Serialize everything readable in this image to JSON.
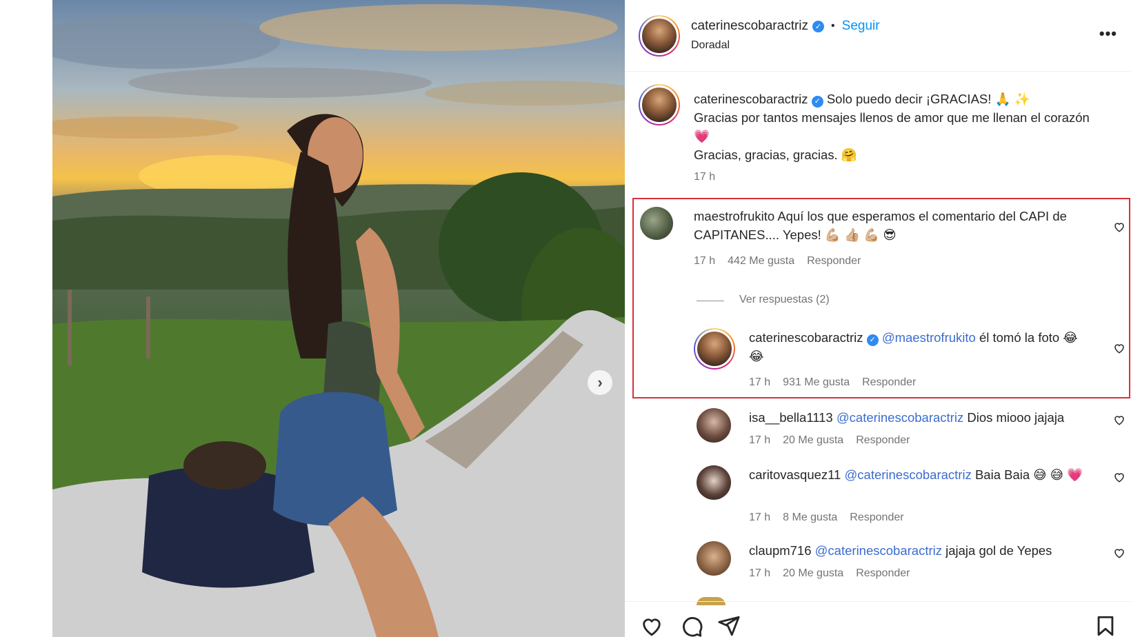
{
  "post": {
    "author": "caterinescobaractriz",
    "follow_label": "Seguir",
    "separator": "•",
    "location": "Doradal",
    "more_label": "•••"
  },
  "caption": {
    "user": "caterinescobaractriz",
    "line1": "Solo puedo decir ¡GRACIAS! 🙏 ✨",
    "line2": "Gracias por tantos mensajes llenos de amor que me llenan el corazón 💗",
    "line3": "Gracias, gracias, gracias. 🤗",
    "time": "17 h"
  },
  "comments": [
    {
      "user": "maestrofrukito",
      "text": "Aquí los que esperamos el comentario del CAPI de CAPITANES.... Yepes! 💪🏼 👍🏼 💪🏼 😎",
      "time": "17 h",
      "likes": "442 Me gusta",
      "reply": "Responder",
      "view_replies": "Ver respuestas (2)"
    },
    {
      "user": "caterinescobaractriz",
      "mention": "@maestrofrukito",
      "text": "él tomó la foto 😂 😂",
      "time": "17 h",
      "likes": "931 Me gusta",
      "reply": "Responder"
    },
    {
      "user": "isa__bella1113",
      "mention": "@caterinescobaractriz",
      "text": "Dios miooo jajaja",
      "time": "17 h",
      "likes": "20 Me gusta",
      "reply": "Responder"
    },
    {
      "user": "caritovasquez11",
      "mention": "@caterinescobaractriz",
      "text": "Baia Baia 😅 😅 💗",
      "time": "17 h",
      "likes": "8 Me gusta",
      "reply": "Responder"
    },
    {
      "user": "claupm716",
      "mention": "@caterinescobaractriz",
      "text": "jajaja gol de Yepes",
      "time": "17 h",
      "likes": "20 Me gusta",
      "reply": "Responder"
    }
  ],
  "icons": {
    "like": "heart-icon",
    "comment": "comment-icon",
    "share": "send-icon",
    "save": "bookmark-icon",
    "next": "chevron-right-icon"
  },
  "colors": {
    "link": "#0095f6",
    "mention": "#3b6ccf",
    "highlight": "#d8303a",
    "verified": "#2f8bf0"
  }
}
